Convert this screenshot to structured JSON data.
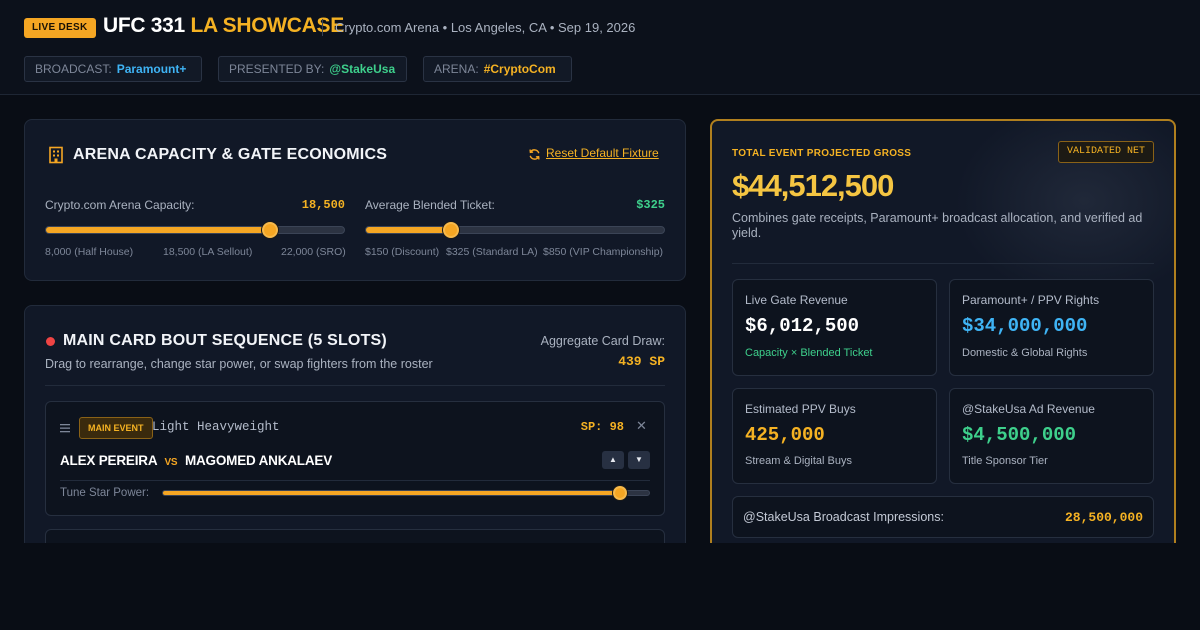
{
  "header": {
    "live_badge": "LIVE DESK",
    "title_main": "UFC 331",
    "title_accent": "LA SHOWCASE",
    "meta": "Crypto.com Arena • Los Angeles, CA • Sep 19, 2026",
    "chips": [
      {
        "key": "BROADCAST:",
        "value": "Paramount+",
        "color": "#3fb4f5"
      },
      {
        "key": "PRESENTED BY:",
        "value": "@StakeUsa",
        "color": "#3ed08c"
      },
      {
        "key": "ARENA:",
        "value": "#CryptoCom",
        "color": "#f5b223"
      }
    ]
  },
  "capacity": {
    "title": "ARENA CAPACITY & GATE ECONOMICS",
    "reset_label": "Reset Default Fixture",
    "capacity_label": "Crypto.com Arena Capacity:",
    "capacity_value": "18,500",
    "capacity_level": 0.75,
    "capacity_ticks": [
      "8,000 (Half House)",
      "18,500 (LA Sellout)",
      "22,000 (SRO)"
    ],
    "ticket_label": "Average Blended Ticket:",
    "ticket_value": "$325",
    "ticket_level": 0.2857,
    "ticket_ticks": [
      "$150 (Discount)",
      "$325 (Standard LA)",
      "$850 (VIP Championship)"
    ]
  },
  "card": {
    "title": "MAIN CARD BOUT SEQUENCE (5 SLOTS)",
    "subtitle": "Drag to rearrange, change star power, or swap fighters from the roster",
    "draw_label": "Aggregate Card Draw:",
    "draw_value": "439 SP",
    "bouts": [
      {
        "tag": "MAIN EVENT",
        "division": "Light Heavyweight",
        "sp": "SP: 98",
        "fighter_a": "ALEX PEREIRA",
        "vs": "VS",
        "fighter_b": "MAGOMED ANKALAEV",
        "tune_label": "Tune Star Power:",
        "star_level": 0.94
      }
    ]
  },
  "summary": {
    "eyebrow": "TOTAL EVENT PROJECTED GROSS",
    "badge": "VALIDATED NET",
    "gross": "$44,512,500",
    "description": "Combines gate receipts, Paramount+ broadcast allocation, and verified ad yield.",
    "cards": [
      {
        "label": "Live Gate Revenue",
        "value": "$6,012,500",
        "sub": "Capacity × Blended Ticket",
        "value_color": "#ffffff",
        "sub_color": "#3ed08c"
      },
      {
        "label": "Paramount+ / PPV Rights",
        "value": "$34,000,000",
        "sub": "Domestic & Global Rights",
        "value_color": "#3fb4f5",
        "sub_color": "#aab2c0"
      },
      {
        "label": "Estimated PPV Buys",
        "value": "425,000",
        "sub": "Stream & Digital Buys",
        "value_color": "#f5b223",
        "sub_color": "#aab2c0"
      },
      {
        "label": "@StakeUsa Ad Revenue",
        "value": "$4,500,000",
        "sub": "Title Sponsor Tier",
        "value_color": "#3ed08c",
        "sub_color": "#aab2c0"
      }
    ],
    "impressions_label": "@StakeUsa Broadcast Impressions:",
    "impressions_value": "28,500,000"
  },
  "colors": {
    "accent": "#f5a623",
    "danger": "#ef4444",
    "success": "#3ed08c",
    "info": "#3fb4f5"
  },
  "icons": [
    "building-icon",
    "refresh-icon",
    "live-dot-icon",
    "drag-handle-icon",
    "close-icon",
    "arrow-up-icon",
    "arrow-down-icon"
  ]
}
